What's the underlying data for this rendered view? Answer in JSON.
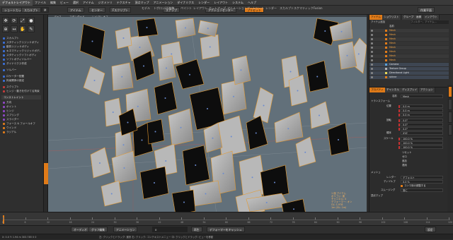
{
  "menubar": {
    "layout_select": "デフォルトレイアウト",
    "items": [
      "ファイル",
      "編集",
      "ビュー",
      "選択",
      "アイテム",
      "ジオメトリ",
      "テクスチャ",
      "頂点マップ",
      "アニメーション",
      "ダイナミクス",
      "レンダー",
      "レイアウト",
      "システム",
      "ヘルプ"
    ]
  },
  "toolbar": {
    "buttons": [
      "ショートカット",
      "スカルプト"
    ],
    "mode_label": "M",
    "tabs": [
      "モデル",
      "トポロジ",
      "UV編集",
      "ペイント",
      "レイアウト",
      "セットアップ",
      "アニメーション",
      "ゲームツール",
      "レンダー",
      "スカルプト",
      "スケマティックFusion"
    ],
    "right_button": "作業平面",
    "select_items": "アイテム",
    "action_center": "センター",
    "falloff": "Fスクリプト",
    "snapping": "スナップ",
    "symmetry_mode": "アクションセンター",
    "preset": "プリセット"
  },
  "left_panel": {
    "section_create": "スカルプト",
    "items": [
      {
        "label": "スカルプト",
        "color": "#3b6fd6"
      },
      {
        "label": "スタティックリジッドボディ",
        "color": "#3b6fd6"
      },
      {
        "label": "動的リジッドボディ",
        "color": "#3b6fd6"
      },
      {
        "label": "キネマティックリジッドボディ",
        "color": "#3b6fd6"
      },
      {
        "label": "スタティックソフトボディ",
        "color": "#3b6fd6"
      },
      {
        "label": "ソフトボディソルバー",
        "color": "#3b6fd6"
      },
      {
        "label": "ダイナミクス作成",
        "color": "#3b6fd6"
      }
    ],
    "section_solver": "ソルバー",
    "solver_items": [
      {
        "label": "ソルバー",
        "color": "#3b6fd6"
      }
    ],
    "section_constraints_a": "ロケーター配置",
    "constraint_items_a": [
      {
        "label": "ロケーター配置",
        "color": "#3b6fd6"
      },
      {
        "label": "拘束関係の設定",
        "color": "#3b6fd6"
      }
    ],
    "section_hinge": "スクリプト",
    "hinge_items": [
      {
        "label": "スクリプト",
        "color": "#c43b3b"
      },
      {
        "label": "ヒンジ・動きを付けてる拘束",
        "color": "#c43b3b"
      }
    ],
    "section_constraints": "コンストレイント",
    "constraint_items": [
      {
        "label": "方向",
        "color": "#8e47c4"
      },
      {
        "label": "ポイント",
        "color": "#8e47c4"
      },
      {
        "label": "ヒンジ",
        "color": "#8e47c4"
      },
      {
        "label": "スプリング",
        "color": "#8e47c4"
      },
      {
        "label": "スライダー",
        "color": "#8e47c4"
      },
      {
        "label": "フォース & フォールオフ",
        "color": "#e07b19"
      },
      {
        "label": "ウインド",
        "color": "#e07b19"
      },
      {
        "label": "ラジアル",
        "color": "#e07b19"
      }
    ]
  },
  "viewport": {
    "header": [
      "パース",
      "スタンダード",
      "レイ GL: オフ"
    ],
    "info_lines": [
      "1 個 アイテム",
      "ポリゴン: 面",
      "チャンネル: 0",
      "デフォーマー: オン",
      "GL: 1,978",
      "1m (GL: 1m)"
    ]
  },
  "right_panel": {
    "tabs": [
      "アイテム",
      "ショウリスト",
      "グループ",
      "画像",
      "インアウト"
    ],
    "filter_label": "アイテム追加",
    "filter_value": "フィルター、アイテム...",
    "col_name": "名前",
    "items": [
      {
        "name": "Mesh",
        "color": "#e07b19",
        "indent": 0
      },
      {
        "name": "Mesh",
        "color": "#e07b19",
        "indent": 0
      },
      {
        "name": "Mesh",
        "color": "#e07b19",
        "indent": 0
      },
      {
        "name": "Mesh",
        "color": "#e07b19",
        "indent": 0
      },
      {
        "name": "Mesh",
        "color": "#e07b19",
        "indent": 0
      },
      {
        "name": "Mesh",
        "color": "#e07b19",
        "indent": 0
      },
      {
        "name": "Mesh",
        "color": "#e07b19",
        "indent": 0
      },
      {
        "name": "Mesh",
        "color": "#e07b19",
        "indent": 0
      },
      {
        "name": "Camera",
        "color": "#5aa0d8",
        "indent": 0
      },
      {
        "name": "Texture Group",
        "color": "#b0b0b0",
        "indent": 0
      },
      {
        "name": "Directional Light",
        "color": "#e6d85a",
        "indent": 0
      },
      {
        "name": "skinnr",
        "color": "#e07b19",
        "indent": 0
      }
    ],
    "prop_tabs": [
      "プロパティ",
      "チャンネル",
      "ディスプレイ",
      "アクション"
    ],
    "prop_name_label": "名前",
    "prop_name_value": "Mesh",
    "transform_label": "トランスフォーム",
    "position_label": "位置",
    "rotation_label": "回転",
    "scale_label": "スケール",
    "order_label": "順序",
    "order_value": "XYZ",
    "position": [
      "0.0 m",
      "0.0 m",
      "0.0 m"
    ],
    "rotation": [
      "0.0°",
      "0.0°",
      "0.0°"
    ],
    "scale": [
      "100.0 %",
      "100.0 %",
      "100.0 %"
    ],
    "reset_items": [
      "リセット",
      "ゼロ",
      "追加",
      "適用"
    ],
    "mesh_label": "メッシュ",
    "render_label": "レンダー",
    "render_value": "デフォルト",
    "dissolve_label": "ディゾルブ",
    "dissolve_value": "0.0 %",
    "render_toggle": "コンマ用の調整する",
    "smooth_label": "スムージング",
    "smooth_value": "常に",
    "vertex_label": "頂点マップ"
  },
  "timeline": {
    "ticks": [
      "0",
      "6",
      "12",
      "18",
      "24",
      "30",
      "36",
      "42",
      "48",
      "54",
      "60",
      "66",
      "72",
      "78",
      "84",
      "90",
      "96",
      "102",
      "108",
      "114",
      "120"
    ]
  },
  "bottombar": {
    "audio": "オーディオ",
    "graph": "グラフ編集",
    "animation": "アニメーション",
    "frame_value": "0",
    "play": "再生",
    "cache": "デフォーマーをキャッシュ",
    "settings": "設定"
  },
  "status": {
    "left": "X: 0.0  Y: 1.94 m  303.785 0 0",
    "right": "左: クリックとドラッグ: 選択  右: クリック: コンテキストメニュー  中: クリックとドラッグ: ビューを移動"
  },
  "colors": {
    "accent": "#e07b19",
    "viewport_bg": "#62707a"
  }
}
